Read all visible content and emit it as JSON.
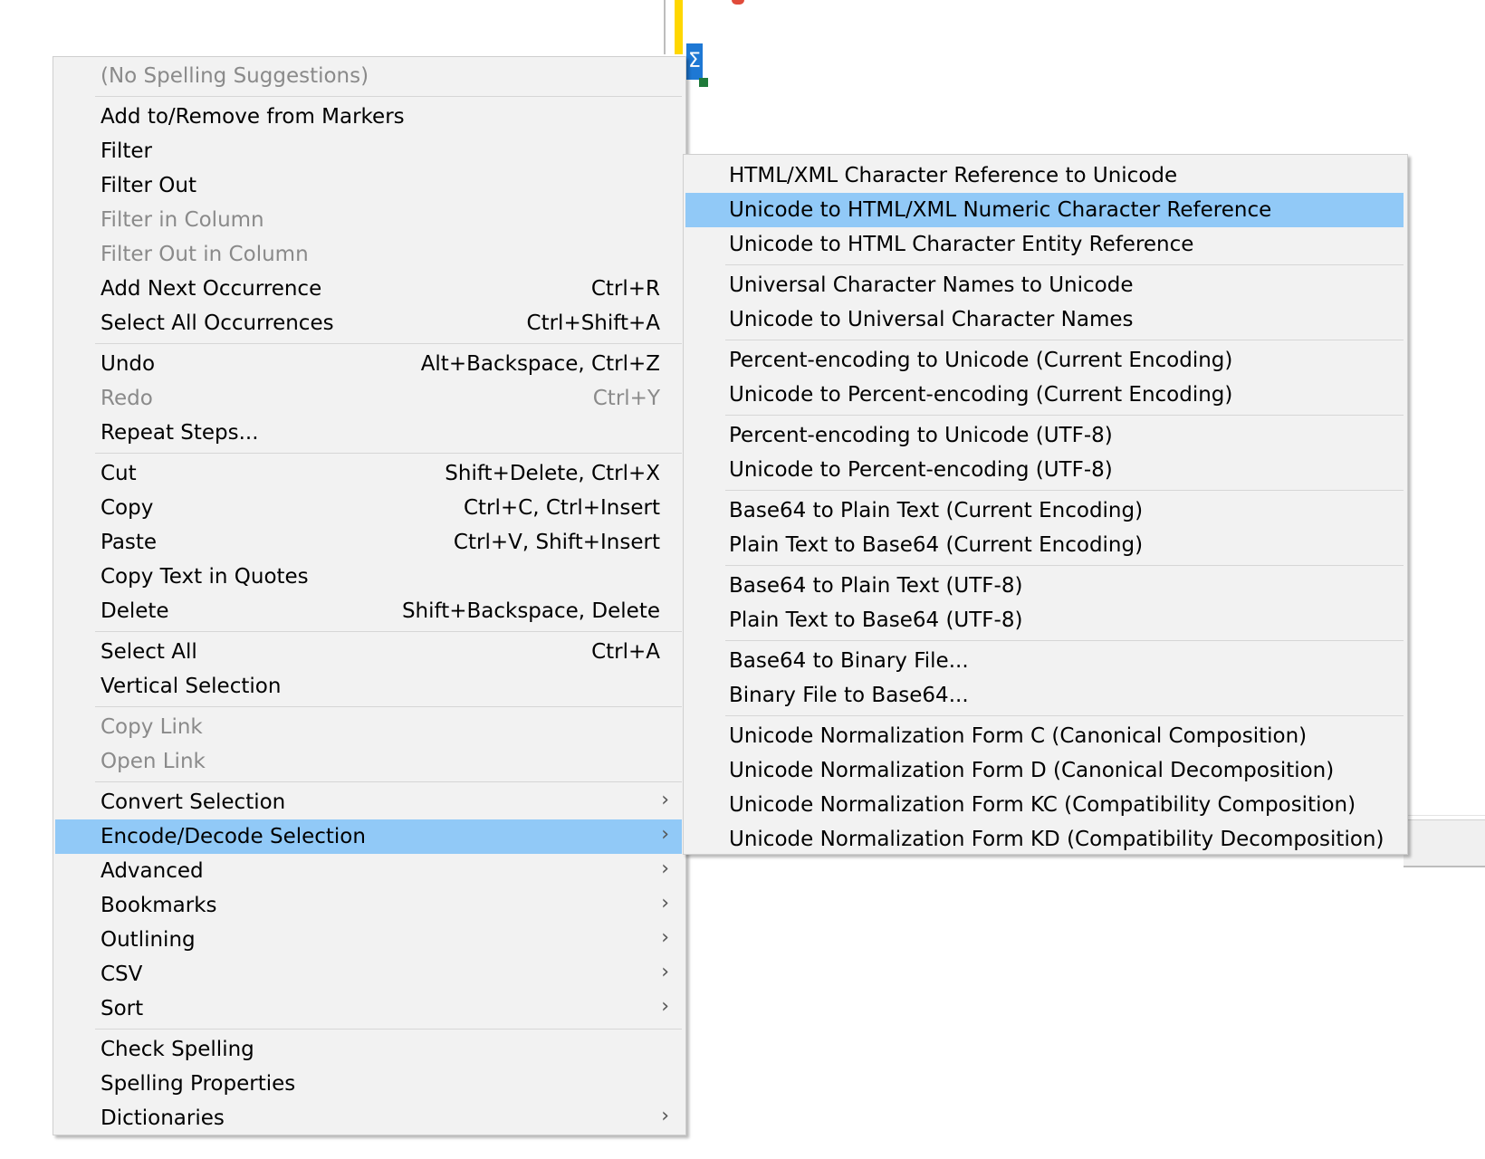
{
  "background": {
    "sigma_glyph": "Σ",
    "colors": {
      "yellow_bar": "#ffd700",
      "sigma_bg": "#1e78d4",
      "corner": "#1f7a3a"
    }
  },
  "context_menu": {
    "highlight_color": "#91c9f7",
    "items": [
      {
        "label": "(No Spelling Suggestions)",
        "disabled": true
      },
      {
        "label": "Add to/Remove from Markers"
      },
      {
        "label": "Filter"
      },
      {
        "label": "Filter Out"
      },
      {
        "label": "Filter in Column",
        "disabled": true
      },
      {
        "label": "Filter Out in Column",
        "disabled": true
      },
      {
        "label": "Add Next Occurrence",
        "shortcut": "Ctrl+R"
      },
      {
        "label": "Select All Occurrences",
        "shortcut": "Ctrl+Shift+A"
      },
      {
        "label": "Undo",
        "shortcut": "Alt+Backspace, Ctrl+Z"
      },
      {
        "label": "Redo",
        "shortcut": "Ctrl+Y",
        "disabled": true
      },
      {
        "label": "Repeat Steps..."
      },
      {
        "label": "Cut",
        "shortcut": "Shift+Delete, Ctrl+X"
      },
      {
        "label": "Copy",
        "shortcut": "Ctrl+C, Ctrl+Insert"
      },
      {
        "label": "Paste",
        "shortcut": "Ctrl+V, Shift+Insert"
      },
      {
        "label": "Copy Text in Quotes"
      },
      {
        "label": "Delete",
        "shortcut": "Shift+Backspace, Delete"
      },
      {
        "label": "Select All",
        "shortcut": "Ctrl+A"
      },
      {
        "label": "Vertical Selection"
      },
      {
        "label": "Copy Link",
        "disabled": true
      },
      {
        "label": "Open Link",
        "disabled": true
      },
      {
        "label": "Convert Selection",
        "arrow": "›"
      },
      {
        "label": "Encode/Decode Selection",
        "arrow": "›",
        "highlighted": true
      },
      {
        "label": "Advanced",
        "arrow": "›"
      },
      {
        "label": "Bookmarks",
        "arrow": "›"
      },
      {
        "label": "Outlining",
        "arrow": "›"
      },
      {
        "label": "CSV",
        "arrow": "›"
      },
      {
        "label": "Sort",
        "arrow": "›"
      },
      {
        "label": "Check Spelling"
      },
      {
        "label": "Spelling Properties"
      },
      {
        "label": "Dictionaries",
        "arrow": "›"
      }
    ]
  },
  "submenu": {
    "items": [
      {
        "label": "HTML/XML Character Reference to Unicode"
      },
      {
        "label": "Unicode to HTML/XML Numeric Character Reference",
        "highlighted": true
      },
      {
        "label": "Unicode to HTML Character Entity Reference"
      },
      {
        "label": "Universal Character Names to Unicode"
      },
      {
        "label": "Unicode to Universal Character Names"
      },
      {
        "label": "Percent-encoding to Unicode (Current Encoding)"
      },
      {
        "label": "Unicode to Percent-encoding (Current Encoding)"
      },
      {
        "label": "Percent-encoding to Unicode (UTF-8)"
      },
      {
        "label": "Unicode to Percent-encoding (UTF-8)"
      },
      {
        "label": "Base64 to Plain Text (Current Encoding)"
      },
      {
        "label": "Plain Text to Base64 (Current Encoding)"
      },
      {
        "label": "Base64 to Plain Text (UTF-8)"
      },
      {
        "label": "Plain Text to Base64 (UTF-8)"
      },
      {
        "label": "Base64 to Binary File..."
      },
      {
        "label": "Binary File to Base64..."
      },
      {
        "label": "Unicode Normalization Form C (Canonical Composition)"
      },
      {
        "label": "Unicode Normalization Form D (Canonical Decomposition)"
      },
      {
        "label": "Unicode Normalization Form KC (Compatibility Composition)"
      },
      {
        "label": "Unicode Normalization Form KD (Compatibility Decomposition)"
      }
    ]
  }
}
